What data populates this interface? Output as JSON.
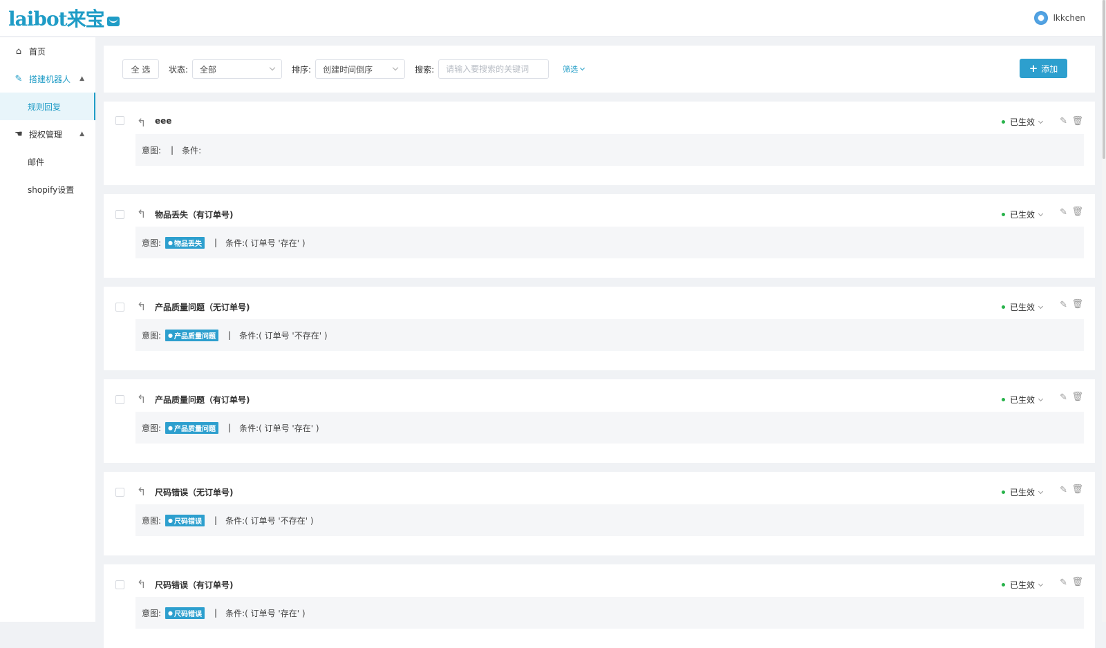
{
  "app": {
    "logo_text": "laibot来宝",
    "user_name": "lkkchen"
  },
  "sidebar": {
    "items": [
      {
        "label": "首页",
        "icon": "home-icon"
      },
      {
        "label": "搭建机器人",
        "icon": "edit-icon",
        "expanded": true,
        "children": [
          {
            "label": "规则回复",
            "active": true
          }
        ]
      },
      {
        "label": "授权管理",
        "icon": "handshake-icon",
        "expanded": true,
        "children": [
          {
            "label": "邮件"
          },
          {
            "label": "shopify设置"
          }
        ]
      }
    ]
  },
  "toolbar": {
    "select_all_label": "全 选",
    "status_label": "状态:",
    "status_value": "全部",
    "sort_label": "排序:",
    "sort_value": "创建时间倒序",
    "search_label": "搜索:",
    "search_placeholder": "请输入要搜索的关键词",
    "filter_label": "筛选",
    "add_label": "添加"
  },
  "rules": [
    {
      "title": "eee",
      "status": "已生效",
      "intent_label": "意图:",
      "intent_tag": "",
      "condition_label": "条件:",
      "condition": ""
    },
    {
      "title": "物品丢失（有订单号)",
      "status": "已生效",
      "intent_label": "意图:",
      "intent_tag": "物品丢失",
      "condition_label": "条件:",
      "condition": "( 订单号 '存在' )"
    },
    {
      "title": "产品质量问题（无订单号)",
      "status": "已生效",
      "intent_label": "意图:",
      "intent_tag": "产品质量问题",
      "condition_label": "条件:",
      "condition": "( 订单号 '不存在' )"
    },
    {
      "title": "产品质量问题（有订单号)",
      "status": "已生效",
      "intent_label": "意图:",
      "intent_tag": "产品质量问题",
      "condition_label": "条件:",
      "condition": "( 订单号 '存在' )"
    },
    {
      "title": "尺码错误（无订单号)",
      "status": "已生效",
      "intent_label": "意图:",
      "intent_tag": "尺码错误",
      "condition_label": "条件:",
      "condition": "( 订单号 '不存在' )"
    },
    {
      "title": "尺码错误（有订单号)",
      "status": "已生效",
      "intent_label": "意图:",
      "intent_tag": "尺码错误",
      "condition_label": "条件:",
      "condition": "( 订单号 '存在' )"
    }
  ],
  "colors": {
    "accent": "#2d9fce",
    "status_active": "#27b24a"
  }
}
